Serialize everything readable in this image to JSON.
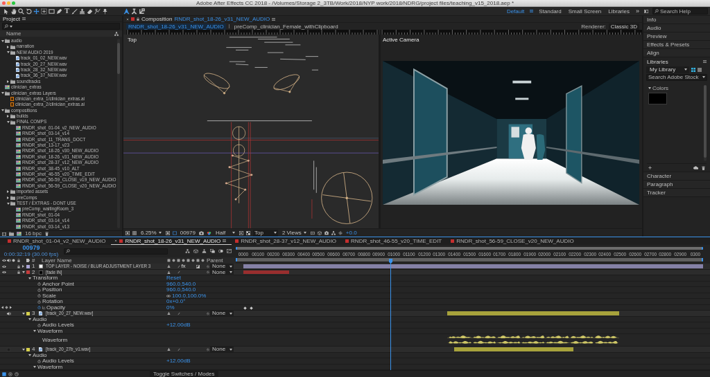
{
  "window": {
    "title": "Adobe After Effects CC 2018 - /Volumes/Storage 2_3TB/Work/2018/NYP work/2018/NDRG/project files/teaching_v15_2018.aep *"
  },
  "toolbar": {
    "tools": [
      {
        "kind": "selection",
        "selected": false
      },
      {
        "kind": "hand",
        "selected": false
      },
      {
        "kind": "zoom",
        "selected": false
      },
      {
        "kind": "rotate",
        "selected": false
      },
      {
        "kind": "camera",
        "selected": true
      },
      {
        "kind": "pan_behind",
        "selected": false
      },
      {
        "kind": "rectangle",
        "selected": false
      },
      {
        "kind": "pen",
        "selected": false
      },
      {
        "kind": "type",
        "selected": false,
        "glyph": "T"
      },
      {
        "kind": "brush",
        "selected": false
      },
      {
        "kind": "stamp",
        "selected": false
      },
      {
        "kind": "eraser",
        "selected": false
      },
      {
        "kind": "roto",
        "selected": false
      },
      {
        "kind": "pin",
        "selected": false
      }
    ],
    "axis_modes": [
      {
        "kind": "local",
        "selected": true
      },
      {
        "kind": "world",
        "selected": false
      },
      {
        "kind": "view",
        "selected": false
      }
    ],
    "workspaces": [
      {
        "label": "Default",
        "selected": true
      },
      {
        "label": "Standard",
        "selected": false
      },
      {
        "label": "Small Screen",
        "selected": false
      },
      {
        "label": "Libraries",
        "selected": false
      }
    ],
    "overflow": "»",
    "search": {
      "placeholder": "Search Help"
    }
  },
  "project": {
    "title": "Project",
    "column": "Name",
    "bit_depth": "16 bpc",
    "items": [
      {
        "name": "audio",
        "kind": "folder",
        "expanded": true,
        "children": [
          {
            "name": "narration",
            "kind": "folder",
            "expanded": false
          },
          {
            "name": "NEW AUDIO 2019",
            "kind": "folder",
            "expanded": true,
            "children": [
              {
                "name": "track_01_02_NEW.wav",
                "kind": "audio"
              },
              {
                "name": "track_20_27_NEW.wav",
                "kind": "audio"
              },
              {
                "name": "track_28_32_NEW.wav",
                "kind": "audio"
              },
              {
                "name": "track_36_37_NEW.wav",
                "kind": "audio"
              }
            ]
          },
          {
            "name": "soundtracks",
            "kind": "folder",
            "expanded": false
          }
        ]
      },
      {
        "name": "clinician_extras",
        "kind": "comp"
      },
      {
        "name": "clinician_extras Layers",
        "kind": "folder",
        "expanded": true,
        "children": [
          {
            "name": "clinician_extra_1/clinician_extras.ai",
            "kind": "ai"
          },
          {
            "name": "clinician_extra_2/clinician_extras.ai",
            "kind": "ai"
          }
        ]
      },
      {
        "name": "compositions",
        "kind": "folder",
        "expanded": true,
        "children": [
          {
            "name": "builds",
            "kind": "folder",
            "expanded": false
          },
          {
            "name": "FINAL COMPS",
            "kind": "folder",
            "expanded": true,
            "children": [
              {
                "name": "RNDR_shot_01-04_v2_NEW_AUDIO",
                "kind": "comp"
              },
              {
                "name": "RNDR_shot_03-14_v14",
                "kind": "comp"
              },
              {
                "name": "RNDR_shot_11_TRANS_DOCT",
                "kind": "comp"
              },
              {
                "name": "RNDR_shot_13-17_v23",
                "kind": "comp"
              },
              {
                "name": "RNDR_shot_18-26_v30_NEW_AUDIO",
                "kind": "comp"
              },
              {
                "name": "RNDR_shot_18-26_v31_NEW_AUDIO",
                "kind": "comp"
              },
              {
                "name": "RNDR_shot_28-37_v12_NEW_AUDIO",
                "kind": "comp"
              },
              {
                "name": "RNDR_shot_38-45_v10_ALT",
                "kind": "comp"
              },
              {
                "name": "RNDR_shot_46-55_v20_TIME_EDIT",
                "kind": "comp"
              },
              {
                "name": "RNDR_shot_56-59_CLOSE_v19_NEW_AUDIO",
                "kind": "comp"
              },
              {
                "name": "RNDR_shot_56-59_CLOSE_v20_NEW_AUDIO",
                "kind": "comp"
              }
            ]
          },
          {
            "name": "imported assets",
            "kind": "folder",
            "expanded": false
          },
          {
            "name": "preComps",
            "kind": "folder",
            "expanded": false
          },
          {
            "name": "TEST / EXTRAS - DONT USE",
            "kind": "folder",
            "expanded": true,
            "children": [
              {
                "name": "preComp_waitingRoom_3",
                "kind": "comp"
              },
              {
                "name": "RNDR_shot_01-04",
                "kind": "comp"
              },
              {
                "name": "RNDR_shot_03-14_v14",
                "kind": "comp"
              },
              {
                "name": "RNDR_shot_03-14_v13",
                "kind": "comp"
              }
            ]
          }
        ]
      }
    ]
  },
  "composition": {
    "label": "Composition",
    "name": "RNDR_shot_18-26_v31_NEW_AUDIO",
    "breadcrumbs": [
      {
        "label": "RNDR_shot_18-26_v31_NEW_AUDIO",
        "selected": true
      },
      {
        "label": "preComp_clinician_Female_withClipboard",
        "selected": false
      }
    ],
    "renderer": {
      "label": "Renderer:",
      "value": "Classic 3D"
    },
    "views": [
      {
        "label": "Top",
        "kind": "wireframe"
      },
      {
        "label": "Active Camera",
        "kind": "render"
      }
    ],
    "viewer_bar": {
      "zoom": "6.25%",
      "timecode": "00979",
      "resolution": "Half",
      "view": "Top",
      "layout": "2 Views",
      "exposure": "+0.0"
    }
  },
  "side_panels": {
    "top": [
      {
        "label": "Info"
      },
      {
        "label": "Audio"
      },
      {
        "label": "Preview"
      },
      {
        "label": "Effects & Presets"
      },
      {
        "label": "Align"
      }
    ],
    "libraries": {
      "title": "Libraries",
      "library": "My Library",
      "view_modes": [
        {
          "kind": "grid",
          "selected": true
        },
        {
          "kind": "list",
          "selected": false
        }
      ],
      "search": {
        "placeholder": "Search Adobe Stock"
      },
      "section": {
        "label": "Colors",
        "expanded": true
      },
      "swatches": [
        {
          "color": "#000000"
        }
      ]
    },
    "bottom": [
      {
        "label": "Character"
      },
      {
        "label": "Paragraph"
      },
      {
        "label": "Tracker"
      }
    ]
  },
  "timeline": {
    "tabs": [
      {
        "label": "RNDR_shot_01-04_v2_NEW_AUDIO",
        "selected": false
      },
      {
        "label": "RNDR_shot_18-26_v31_NEW_AUDIO",
        "selected": true
      },
      {
        "label": "RNDR_shot_28-37_v12_NEW_AUDIO",
        "selected": false
      },
      {
        "label": "RNDR_shot_46-55_v20_TIME_EDIT",
        "selected": false
      },
      {
        "label": "RNDR_shot_56-59_CLOSE_v20_NEW_AUDIO",
        "selected": false
      }
    ],
    "timecode": "00979",
    "timecode_detail": "0:00:32:19 (30.00 fps)",
    "columns": {
      "number": "#",
      "name": "Layer Name",
      "parent": "Parent"
    },
    "ruler": [
      "0000",
      "00100",
      "00200",
      "00300",
      "00400",
      "00500",
      "00600",
      "00700",
      "00800",
      "00900",
      "01000",
      "01100",
      "01200",
      "01300",
      "01400",
      "01500",
      "01600",
      "01700",
      "01800",
      "01900",
      "02000",
      "02100",
      "02200",
      "02300",
      "02400",
      "02500",
      "02600",
      "02700",
      "02800",
      "02900",
      "0300"
    ],
    "layers": [
      {
        "number": "1",
        "name": "TOP LAYER - NOISE / BLUR ADJUSTMENT LAYER 3",
        "color": "#aaa5d6",
        "kind": "adjustment",
        "enabled": true,
        "locked": true,
        "expanded": false,
        "effects": {
          "label": "fx",
          "on": true
        },
        "parent": "None"
      },
      {
        "number": "2",
        "name": "[fade IN]",
        "color": "#c43b3b",
        "kind": "solid",
        "enabled": true,
        "locked": true,
        "expanded": true,
        "parent": "None",
        "children": [
          {
            "kind": "group",
            "name": "Transform",
            "value": "Reset",
            "expanded": true,
            "children": [
              {
                "kind": "property",
                "name": "Anchor Point",
                "value": "960.0,540.0",
                "animated": false,
                "linked": false
              },
              {
                "kind": "property",
                "name": "Position",
                "value": "960.0,540.0",
                "animated": false,
                "linked": false
              },
              {
                "kind": "property",
                "name": "Scale",
                "value": "100.0,100.0%",
                "animated": false,
                "linked": true
              },
              {
                "kind": "property",
                "name": "Rotation",
                "value": "0x+0.0°",
                "animated": false,
                "linked": false
              },
              {
                "kind": "property",
                "name": "Opacity",
                "value": "0%",
                "animated": true,
                "linked": false
              }
            ]
          }
        ]
      },
      {
        "number": "3",
        "name": "[track_20_27_NEW.wav]",
        "color": "#d6d04c",
        "kind": "audio",
        "enabled": true,
        "locked": false,
        "expanded": true,
        "parent": "None",
        "children": [
          {
            "kind": "group",
            "name": "Audio",
            "expanded": true,
            "children": [
              {
                "kind": "property",
                "name": "Audio Levels",
                "value": "+12.00dB",
                "animated": false,
                "linked": false
              },
              {
                "kind": "group",
                "name": "Waveform",
                "expanded": true,
                "children": [
                  {
                    "kind": "waveform",
                    "name": "Waveform"
                  }
                ]
              }
            ]
          }
        ]
      },
      {
        "number": "4",
        "name": "[track_20_27b_v1.wav]",
        "color": "#d6d04c",
        "kind": "audio",
        "enabled": false,
        "locked": false,
        "expanded": true,
        "parent": "None",
        "children": [
          {
            "kind": "group",
            "name": "Audio",
            "expanded": true,
            "children": [
              {
                "kind": "property",
                "name": "Audio Levels",
                "value": "+12.00dB",
                "animated": false,
                "linked": false
              },
              {
                "kind": "group",
                "name": "Waveform",
                "expanded": true
              }
            ]
          }
        ]
      }
    ],
    "footer": "Toggle Switches / Modes"
  }
}
